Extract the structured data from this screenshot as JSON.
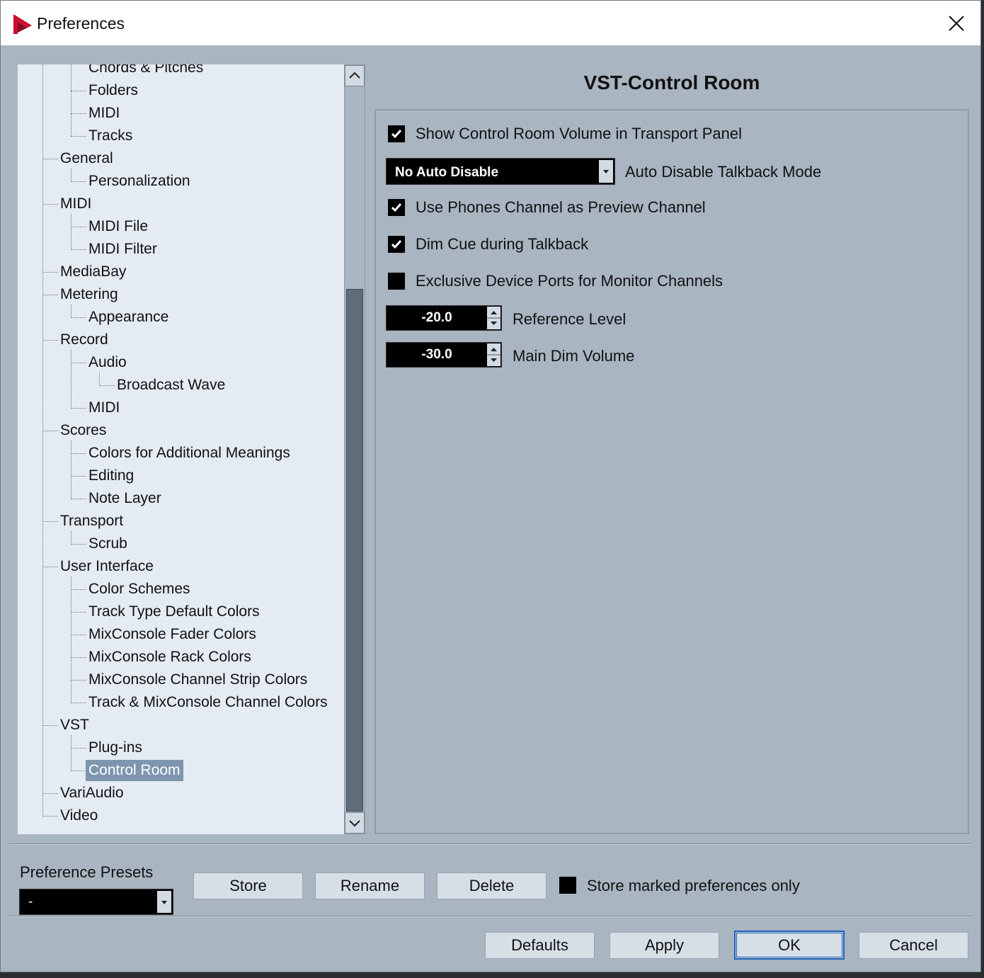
{
  "window": {
    "title": "Preferences"
  },
  "tree": {
    "items": [
      "Chords & Pitches",
      "Folders",
      "MIDI",
      "Tracks",
      "General",
      "Personalization",
      "MIDI",
      "MIDI File",
      "MIDI Filter",
      "MediaBay",
      "Metering",
      "Appearance",
      "Record",
      "Audio",
      "Broadcast Wave",
      "MIDI",
      "Scores",
      "Colors for Additional Meanings",
      "Editing",
      "Note Layer",
      "Transport",
      "Scrub",
      "User Interface",
      "Color Schemes",
      "Track Type Default Colors",
      "MixConsole Fader Colors",
      "MixConsole Rack Colors",
      "MixConsole Channel Strip Colors",
      "Track & MixConsole Channel Colors",
      "VST",
      "Plug-ins",
      "Control Room",
      "VariAudio",
      "Video"
    ],
    "selected": "Control Room"
  },
  "panel": {
    "title": "VST-Control Room",
    "options": {
      "show_volume": {
        "label": "Show Control Room Volume in Transport Panel",
        "checked": true
      },
      "talkback_mode": {
        "value": "No Auto Disable",
        "label": "Auto Disable Talkback Mode"
      },
      "phones_preview": {
        "label": "Use Phones Channel as Preview Channel",
        "checked": true
      },
      "dim_cue": {
        "label": "Dim Cue during Talkback",
        "checked": true
      },
      "exclusive_ports": {
        "label": "Exclusive Device Ports for Monitor Channels",
        "checked": false
      },
      "reference_level": {
        "value": "-20.0",
        "label": "Reference Level"
      },
      "main_dim": {
        "value": "-30.0",
        "label": "Main Dim Volume"
      }
    }
  },
  "presets": {
    "label": "Preference Presets",
    "selected": "-",
    "store": "Store",
    "rename": "Rename",
    "delete": "Delete",
    "marked_only_label": "Store marked preferences only",
    "marked_only_checked": false
  },
  "footer": {
    "defaults": "Defaults",
    "apply": "Apply",
    "ok": "OK",
    "cancel": "Cancel"
  },
  "colors": {
    "background": "#a9b5c1",
    "tree_background": "#e4ebf2",
    "selection": "#7d95ae",
    "control_black": "#000000"
  }
}
